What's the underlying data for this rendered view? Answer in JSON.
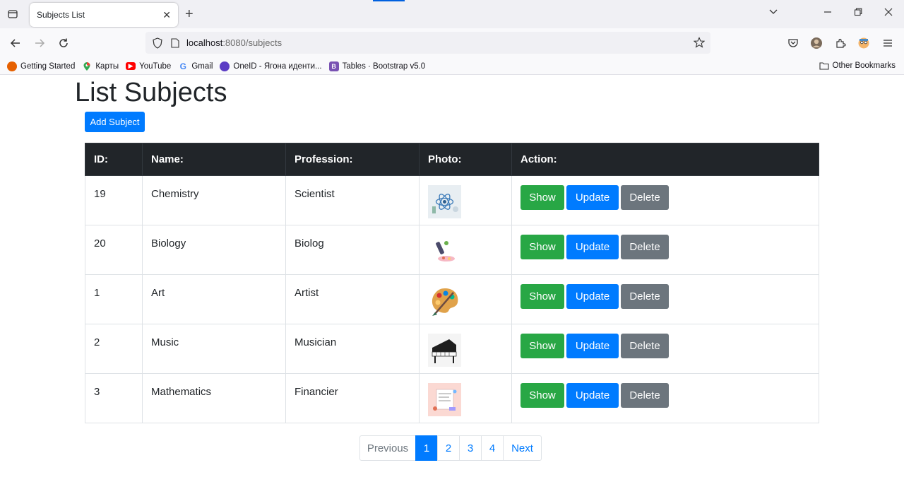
{
  "browser": {
    "tab_title": "Subjects List",
    "url_host": "localhost",
    "url_path": ":8080/subjects",
    "bookmarks": [
      {
        "label": "Getting Started",
        "icon": "firefox-icon",
        "color": "#e66000"
      },
      {
        "label": "Карты",
        "icon": "maps-pin-icon",
        "color": "#34a853"
      },
      {
        "label": "YouTube",
        "icon": "youtube-icon",
        "color": "#ff0000"
      },
      {
        "label": "Gmail",
        "icon": "google-icon",
        "color": "#4285f4"
      },
      {
        "label": "OneID - Ягона иденти...",
        "icon": "oneid-icon",
        "color": "#5b3cc4"
      },
      {
        "label": "Tables · Bootstrap v5.0",
        "icon": "bootstrap-icon",
        "color": "#7952b3"
      }
    ],
    "other_bookmarks": "Other Bookmarks"
  },
  "page": {
    "title": "List Subjects",
    "add_button": "Add Subject"
  },
  "table": {
    "headers": [
      "ID:",
      "Name:",
      "Profession:",
      "Photo:",
      "Action:"
    ],
    "rows": [
      {
        "id": "19",
        "name": "Chemistry",
        "profession": "Scientist",
        "photo": "chemistry-image"
      },
      {
        "id": "20",
        "name": "Biology",
        "profession": "Biolog",
        "photo": "biology-image"
      },
      {
        "id": "1",
        "name": "Art",
        "profession": "Artist",
        "photo": "art-palette-image"
      },
      {
        "id": "2",
        "name": "Music",
        "profession": "Musician",
        "photo": "piano-image"
      },
      {
        "id": "3",
        "name": "Mathematics",
        "profession": "Financier",
        "photo": "mathematics-image"
      }
    ],
    "actions": {
      "show": "Show",
      "update": "Update",
      "delete": "Delete"
    }
  },
  "pagination": {
    "previous": "Previous",
    "pages": [
      "1",
      "2",
      "3",
      "4"
    ],
    "active": "1",
    "next": "Next"
  },
  "colors": {
    "primary": "#007bff",
    "success": "#28a745",
    "secondary": "#6c757d",
    "dark": "#212529"
  }
}
